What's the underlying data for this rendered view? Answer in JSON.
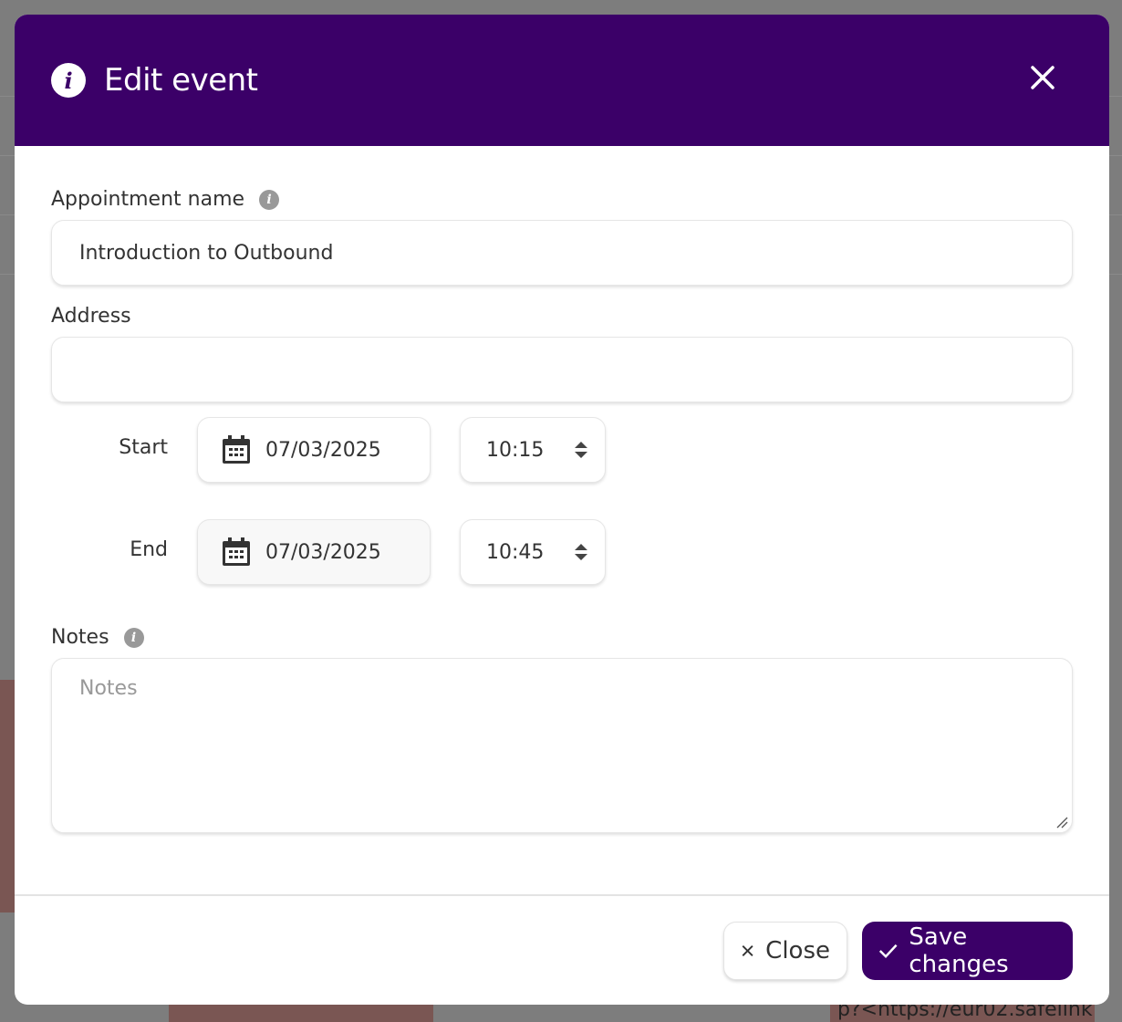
{
  "background": {
    "fragment_text": "p?<https://eur02.safelink"
  },
  "modal": {
    "title": "Edit event",
    "header_icon": "info-circle-icon",
    "close_icon": "close-icon"
  },
  "form": {
    "appointment_name": {
      "label": "Appointment name",
      "value": "Introduction to Outbound",
      "icon": "info-icon"
    },
    "address": {
      "label": "Address",
      "value": ""
    },
    "start": {
      "label": "Start",
      "date": "07/03/2025",
      "time": "10:15"
    },
    "end": {
      "label": "End",
      "date": "07/03/2025",
      "time": "10:45"
    },
    "notes": {
      "label": "Notes",
      "placeholder": "Notes",
      "value": "",
      "icon": "info-icon"
    }
  },
  "footer": {
    "close_label": "Close",
    "save_label": "Save changes"
  },
  "colors": {
    "brand": "#3b0068",
    "overlay": "#7d7d7d"
  }
}
